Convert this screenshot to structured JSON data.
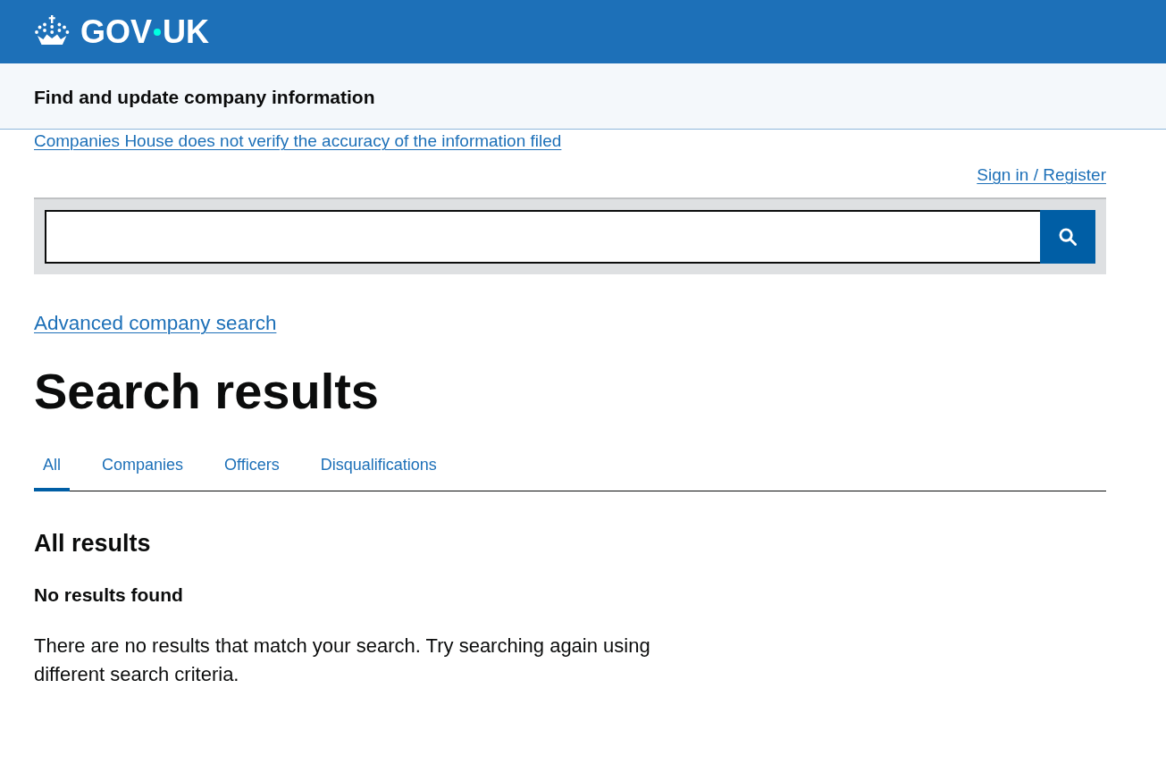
{
  "header": {
    "logo_text": [
      "GOV",
      "UK"
    ]
  },
  "service": {
    "name": "Find and update company information"
  },
  "notice_link": "Companies House does not verify the accuracy of the information filed",
  "account_link": "Sign in / Register",
  "advanced_search_link": "Advanced company search",
  "title": "Search results",
  "tabs": [
    {
      "label": "All",
      "selected": true
    },
    {
      "label": "Companies",
      "selected": false
    },
    {
      "label": "Officers",
      "selected": false
    },
    {
      "label": "Disqualifications",
      "selected": false
    }
  ],
  "results": {
    "heading": "All results",
    "status": "No results found",
    "message": "There are no results that match your search. Try searching again using different search criteria."
  }
}
